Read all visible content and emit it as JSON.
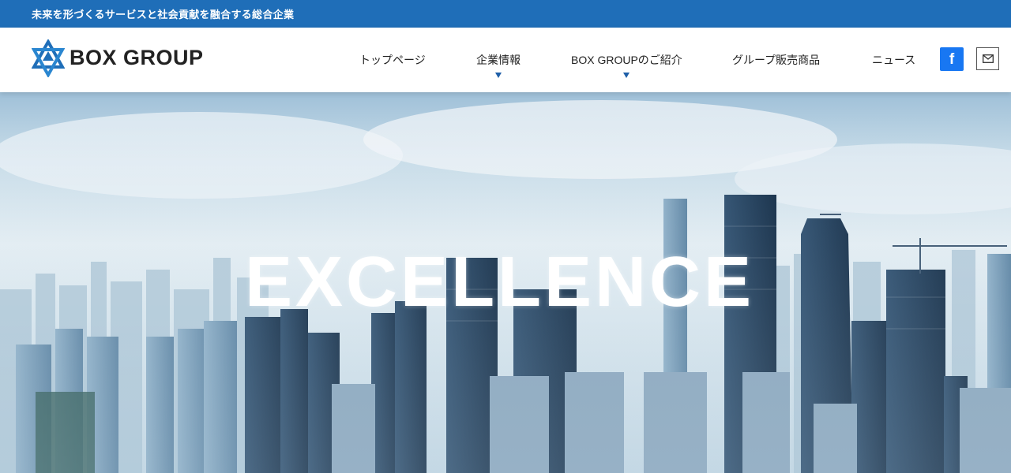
{
  "topbar": {
    "tagline": "未来を形づくるサービスと社会貢献を融合する総合企業"
  },
  "brand": {
    "name": "BOX GROUP",
    "logo_icon": "star-logo-icon",
    "accent": "#1f6eb8"
  },
  "nav": {
    "items": [
      {
        "label": "トップページ",
        "has_dropdown": false
      },
      {
        "label": "企業情報",
        "has_dropdown": true
      },
      {
        "label": "BOX GROUPのご紹介",
        "has_dropdown": true
      },
      {
        "label": "グループ販売商品",
        "has_dropdown": false
      },
      {
        "label": "ニュース",
        "has_dropdown": false
      }
    ],
    "facebook_glyph": "f",
    "facebook_icon": "facebook-icon",
    "mail_icon": "mail-icon"
  },
  "hero": {
    "headline": "EXCELLENCE",
    "background": "city-skyline-image"
  }
}
